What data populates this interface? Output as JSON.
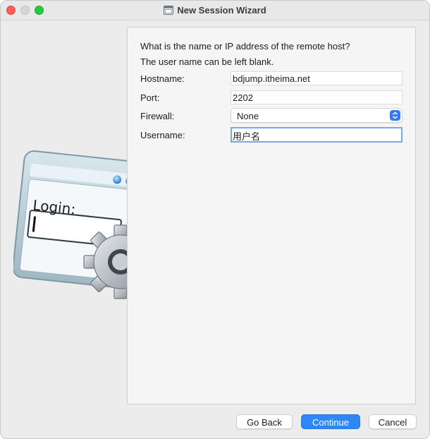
{
  "window": {
    "title": "New Session Wizard",
    "title_icon": "terminal-window-icon"
  },
  "illustration": {
    "login_text": "Login:",
    "icon": "login-gear-icon"
  },
  "wizard": {
    "question_line1": "What is the name or IP address of the remote host?",
    "question_line2": "The user name can be left blank.",
    "fields": {
      "hostname": {
        "label": "Hostname:",
        "value": "bdjump.itheima.net"
      },
      "port": {
        "label": "Port:",
        "value": "2202"
      },
      "firewall": {
        "label": "Firewall:",
        "value": "None"
      },
      "username": {
        "label": "Username:",
        "value": "用户名"
      }
    }
  },
  "buttons": {
    "back": "Go Back",
    "continue": "Continue",
    "cancel": "Cancel"
  },
  "colors": {
    "accent": "#2f86f6",
    "close": "#fe5f57",
    "maximize": "#28c840"
  }
}
